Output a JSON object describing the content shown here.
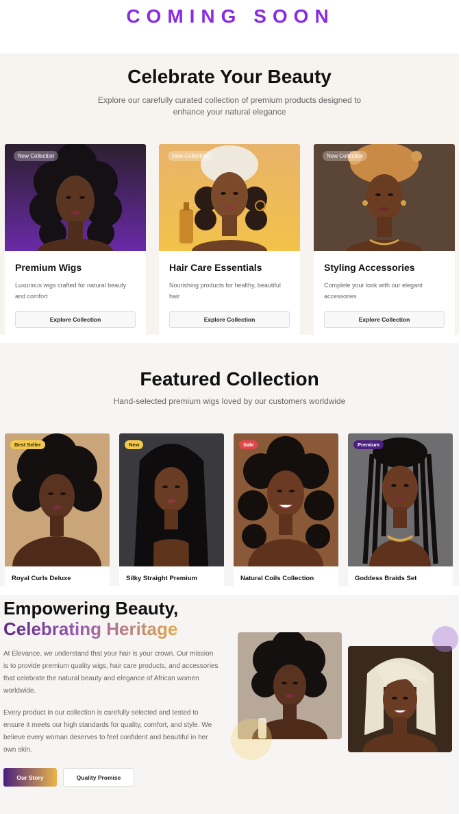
{
  "banner": {
    "text": "COMING SOON",
    "color": "#8a2be2"
  },
  "hero": {
    "title": "Celebrate Your Beauty",
    "subtitle": "Explore our carefully curated collection of premium products designed to enhance your natural elegance"
  },
  "categories": [
    {
      "tag": "New Collection",
      "title": "Premium Wigs",
      "desc": "Luxurious wigs crafted for natural beauty and comfort",
      "button": "Explore Collection",
      "image_icon": "portrait-curly-purple"
    },
    {
      "tag": "New Collection",
      "title": "Hair Care Essentials",
      "desc": "Nourishing products for healthy, beautiful hair",
      "button": "Explore Collection",
      "image_icon": "portrait-headwrap-gold"
    },
    {
      "tag": "New Collection",
      "title": "Styling Accessories",
      "desc": "Complete your look with our elegant accessories",
      "button": "Explore Collection",
      "image_icon": "portrait-headwrap-brown"
    }
  ],
  "featured": {
    "title": "Featured Collection",
    "subtitle": "Hand-selected premium wigs loved by our customers worldwide",
    "products": [
      {
        "badge": "Best Seller",
        "name": "Royal Curls Deluxe",
        "badge_bg": "#f2c94c",
        "badge_fg": "#3a2a00"
      },
      {
        "badge": "New",
        "name": "Silky Straight Premium",
        "badge_bg": "#f2c94c",
        "badge_fg": "#3a2a00"
      },
      {
        "badge": "Sale",
        "name": "Natural Coils Collection",
        "badge_bg": "#e04848",
        "badge_fg": "#ffffff"
      },
      {
        "badge": "Premium",
        "name": "Goddess Braids Set",
        "badge_bg": "#4a1f80",
        "badge_fg": "#ffffff"
      }
    ]
  },
  "about": {
    "title_line1": "Empowering Beauty,",
    "title_line2": "Celebrating Heritage",
    "paragraph1": "At Élevance, we understand that your hair is your crown. Our mission is to provide premium quality wigs, hair care products, and accessories that celebrate the natural beauty and elegance of African women worldwide.",
    "paragraph2": "Every product in our collection is carefully selected and tested to ensure it meets our high standards for quality, comfort, and style. We believe every woman deserves to feel confident and beautiful in her own skin.",
    "primary_button": "Our Story",
    "secondary_button": "Quality Promise"
  }
}
